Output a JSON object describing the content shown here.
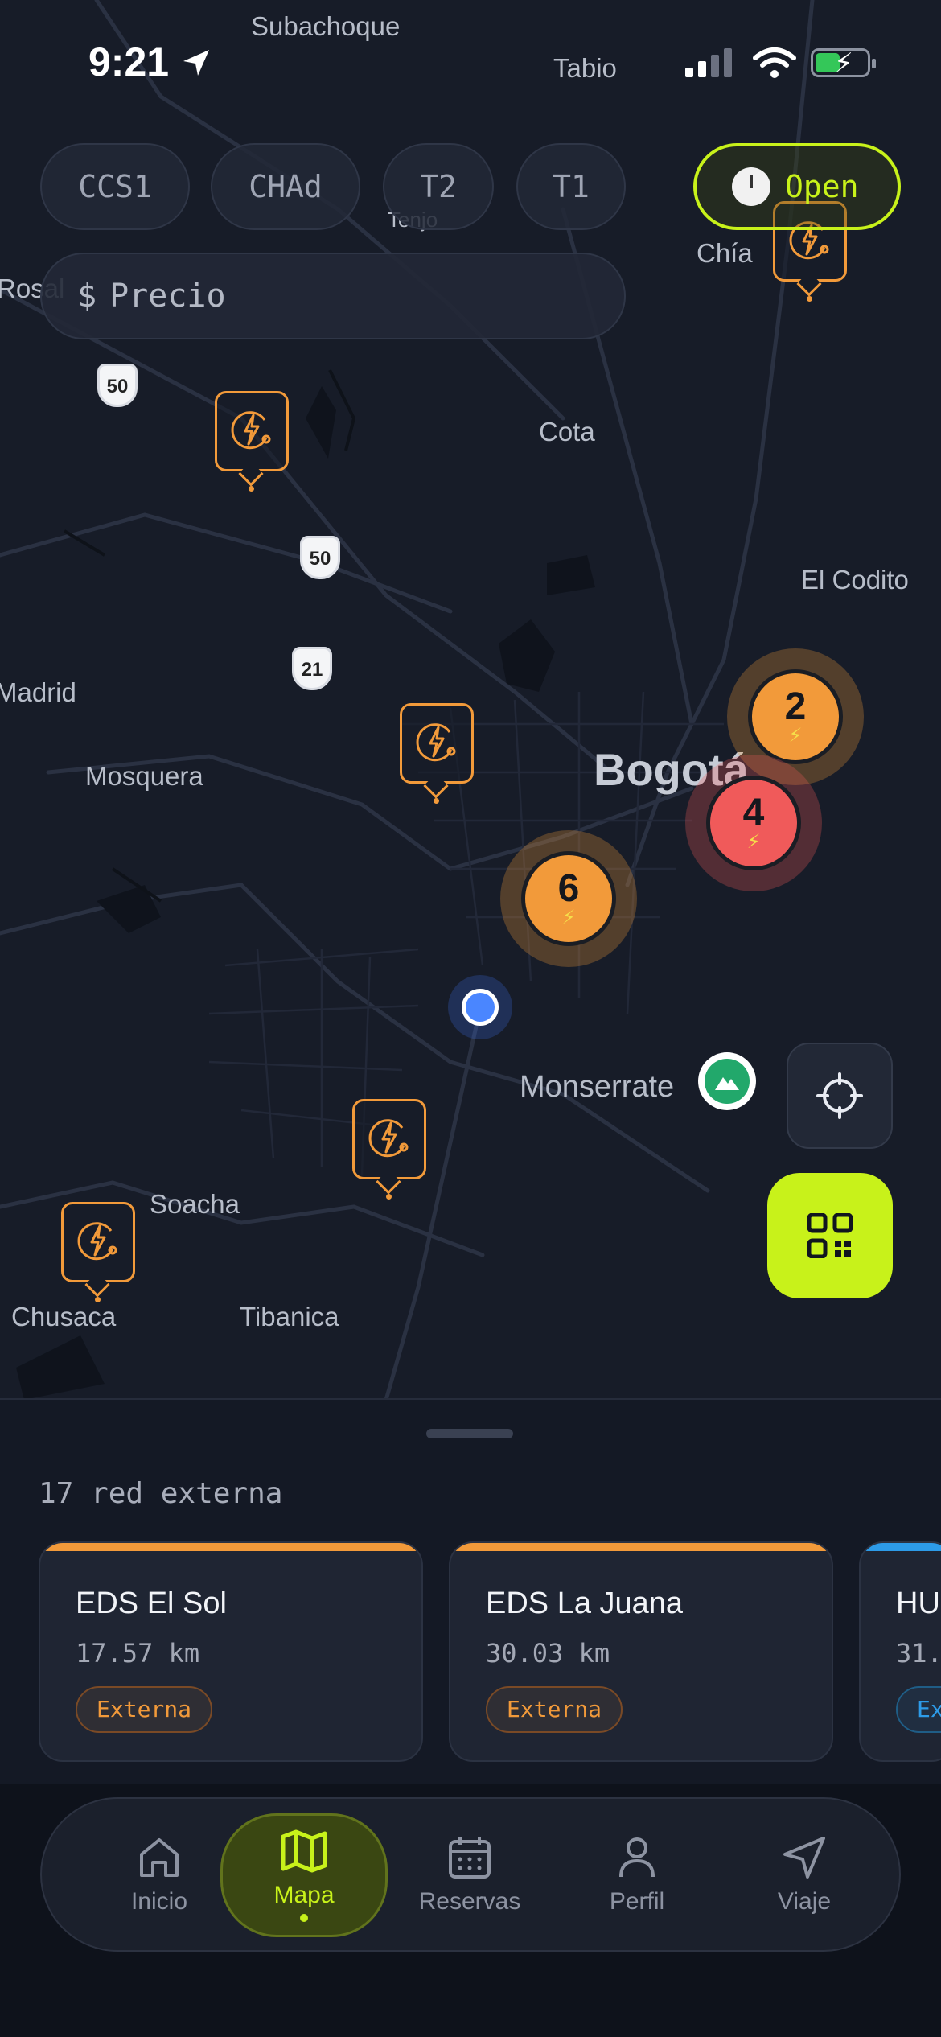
{
  "status_bar": {
    "time": "9:21"
  },
  "filters": {
    "chips": [
      "CCS1",
      "CHAdeMO",
      "T2",
      "T1"
    ],
    "chips_display": [
      "CCS1",
      "CHAd",
      "T2",
      "T1"
    ],
    "open_label": "Open",
    "price_label": "Precio",
    "price_prefix": "$"
  },
  "map": {
    "places": [
      "Subachoque",
      "Tabio",
      "Chía",
      "Tenjo",
      "Cota",
      "El Codito",
      "Madrid",
      "Mosquera",
      "Bogotá",
      "Monserrate",
      "Soacha",
      "Chusaca",
      "Tibanica",
      "Rosal"
    ],
    "route_shields": [
      "50",
      "50",
      "21"
    ],
    "clusters": [
      {
        "count": "2",
        "status": "available"
      },
      {
        "count": "4",
        "status": "busy"
      },
      {
        "count": "6",
        "status": "available"
      }
    ]
  },
  "sheet": {
    "title": "17 red externa",
    "stations": [
      {
        "name": "EDS El Sol",
        "distance": "17.57 km",
        "tag": "Externa"
      },
      {
        "name": "EDS La Juana",
        "distance": "30.03 km",
        "tag": "Externa"
      },
      {
        "name": "HU",
        "distance": "31.",
        "tag": "Ex"
      }
    ]
  },
  "tabs": [
    {
      "label": "Inicio",
      "icon": "home-icon"
    },
    {
      "label": "Mapa",
      "icon": "map-icon"
    },
    {
      "label": "Reservas",
      "icon": "calendar-icon"
    },
    {
      "label": "Perfil",
      "icon": "person-icon"
    },
    {
      "label": "Viaje",
      "icon": "send-icon"
    }
  ],
  "colors": {
    "accent": "#c8f21a",
    "station": "#f29a3a",
    "busy": "#f05a5a",
    "background": "#11151f"
  }
}
